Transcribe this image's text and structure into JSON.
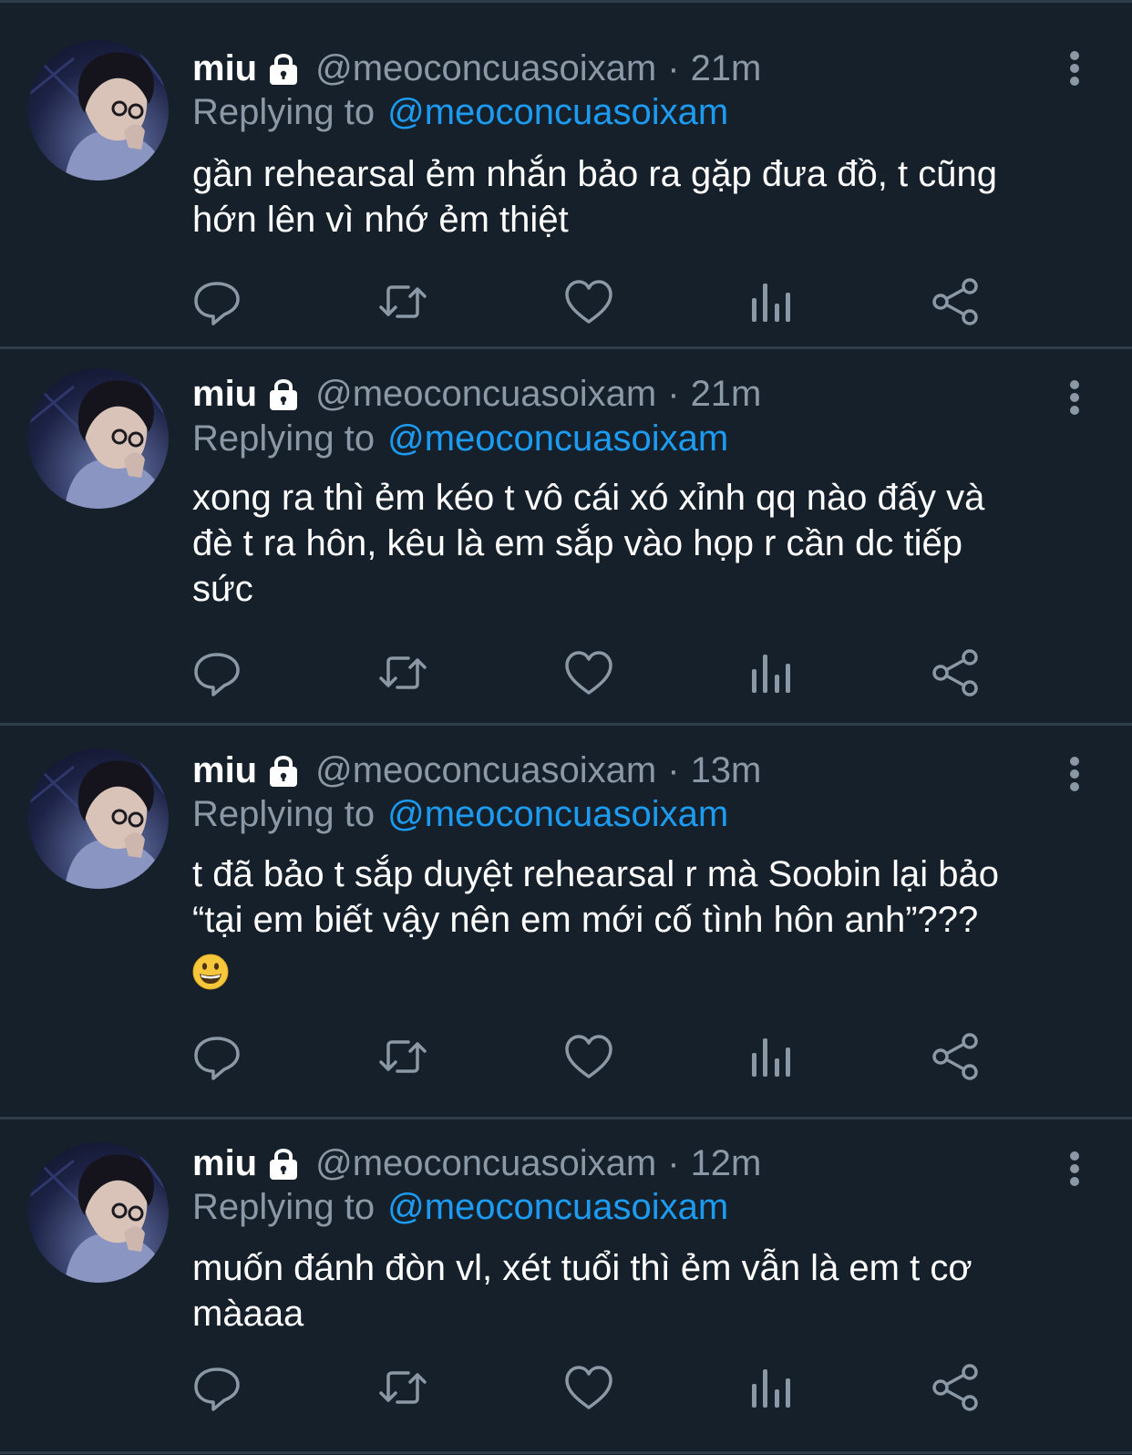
{
  "colors": {
    "background": "#15202b",
    "divider": "#2f3c4a",
    "text_primary": "#ffffff",
    "text_secondary": "#8b98a5",
    "link": "#1d9bf0"
  },
  "tweets": [
    {
      "name": "miu",
      "handle": "@meoconcuasoixam",
      "separator": "·",
      "time": "21m",
      "replying_label": "Replying to",
      "replying_handle": "@meoconcuasoixam",
      "text": "gần rehearsal ẻm nhắn bảo ra gặp đưa đồ, t cũng\nhớn lên vì nhớ ẻm thiệt",
      "icons": [
        "lock-icon",
        "more-icon",
        "reply-icon",
        "retweet-icon",
        "like-icon",
        "analytics-icon",
        "share-icon"
      ]
    },
    {
      "name": "miu",
      "handle": "@meoconcuasoixam",
      "separator": "·",
      "time": "21m",
      "replying_label": "Replying to",
      "replying_handle": "@meoconcuasoixam",
      "text": "xong ra thì ẻm kéo t vô cái xó xỉnh qq nào đấy và\nđè t ra hôn, kêu là em sắp vào họp r cần dc tiếp\nsức",
      "icons": [
        "lock-icon",
        "more-icon",
        "reply-icon",
        "retweet-icon",
        "like-icon",
        "analytics-icon",
        "share-icon"
      ]
    },
    {
      "name": "miu",
      "handle": "@meoconcuasoixam",
      "separator": "·",
      "time": "13m",
      "replying_label": "Replying to",
      "replying_handle": "@meoconcuasoixam",
      "text": "t đã bảo t sắp duyệt rehearsal r mà Soobin lại bảo\n“tại em biết vậy nên em mới cố tình hôn anh”???",
      "emoji": "grinning-face-emoji",
      "icons": [
        "lock-icon",
        "more-icon",
        "reply-icon",
        "retweet-icon",
        "like-icon",
        "analytics-icon",
        "share-icon"
      ]
    },
    {
      "name": "miu",
      "handle": "@meoconcuasoixam",
      "separator": "·",
      "time": "12m",
      "replying_label": "Replying to",
      "replying_handle": "@meoconcuasoixam",
      "text": "muốn đánh đòn vl, xét tuổi thì ẻm vẫn là em t cơ\nmàaaa",
      "icons": [
        "lock-icon",
        "more-icon",
        "reply-icon",
        "retweet-icon",
        "like-icon",
        "analytics-icon",
        "share-icon"
      ]
    }
  ]
}
